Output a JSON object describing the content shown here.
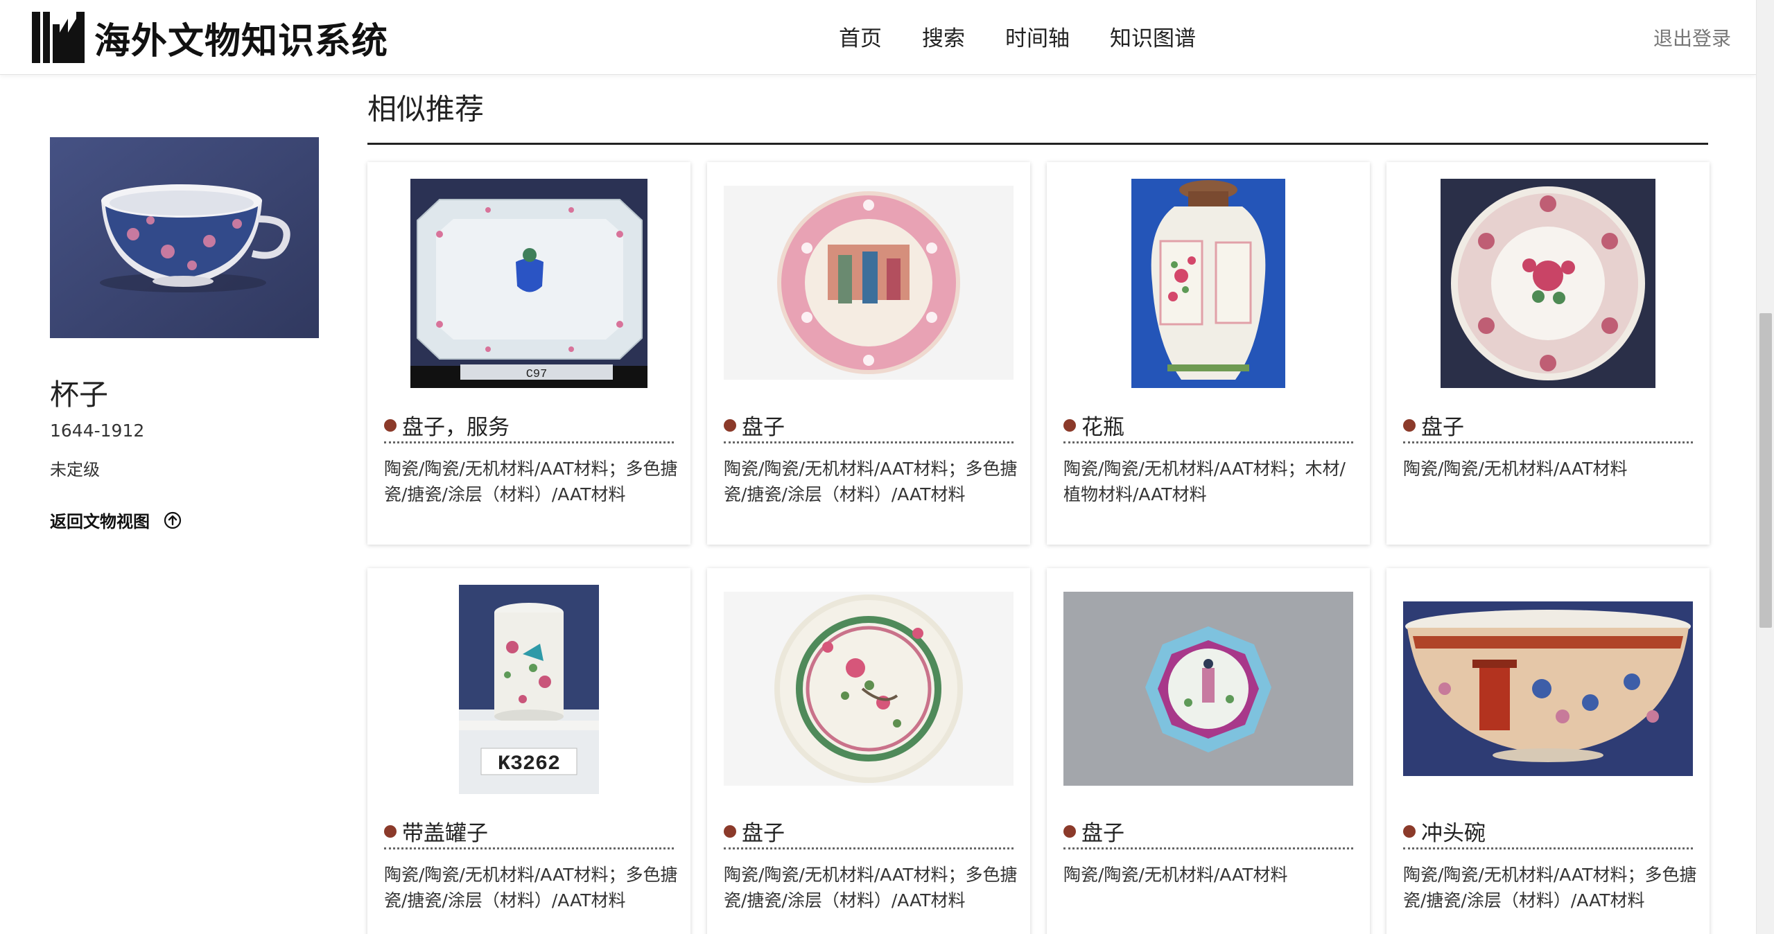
{
  "header": {
    "logo_text": "海外文物知识系统",
    "nav": [
      "首页",
      "搜索",
      "时间轴",
      "知识图谱"
    ],
    "logout": "退出登录"
  },
  "sidebar": {
    "title": "杯子",
    "date": "1644-1912",
    "grade": "未定级",
    "back_label": "返回文物视图",
    "back_icon": "arrow-up-circle-icon"
  },
  "section": {
    "title": "相似推荐"
  },
  "cards": [
    {
      "title": "盘子，服务",
      "desc": "陶瓷/陶瓷/无机材料/AAT材料；多色搪瓷/搪瓷/涂层（材料）/AAT材料",
      "label": "C97"
    },
    {
      "title": "盘子",
      "desc": "陶瓷/陶瓷/无机材料/AAT材料；多色搪瓷/搪瓷/涂层（材料）/AAT材料"
    },
    {
      "title": "花瓶",
      "desc": "陶瓷/陶瓷/无机材料/AAT材料；木材/植物材料/AAT材料"
    },
    {
      "title": "盘子",
      "desc": "陶瓷/陶瓷/无机材料/AAT材料"
    },
    {
      "title": "带盖罐子",
      "desc": "陶瓷/陶瓷/无机材料/AAT材料；多色搪瓷/搪瓷/涂层（材料）/AAT材料",
      "label": "K3262"
    },
    {
      "title": "盘子",
      "desc": "陶瓷/陶瓷/无机材料/AAT材料；多色搪瓷/搪瓷/涂层（材料）/AAT材料"
    },
    {
      "title": "盘子",
      "desc": "陶瓷/陶瓷/无机材料/AAT材料"
    },
    {
      "title": "冲头碗",
      "desc": "陶瓷/陶瓷/无机材料/AAT材料；多色搪瓷/搪瓷/涂层（材料）/AAT材料"
    }
  ],
  "colors": {
    "title_dot": "#8b3a2a",
    "rule": "#222222"
  }
}
